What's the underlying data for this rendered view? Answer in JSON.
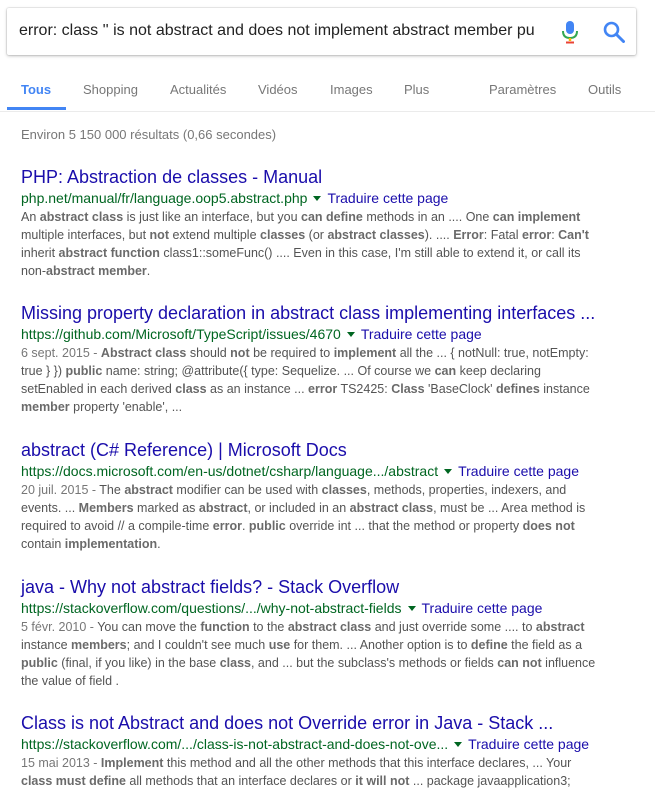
{
  "search": {
    "query": "error: class '' is not abstract and does not implement abstract member pu",
    "mic_icon": "microphone-icon",
    "search_icon": "magnifier-icon",
    "mic_colors": [
      "#4285f4",
      "#34a853",
      "#fbbc05",
      "#ea4335"
    ],
    "search_icon_color": "#4285f4"
  },
  "tabs": [
    {
      "label": "Tous",
      "active": true
    },
    {
      "label": "Shopping",
      "active": false
    },
    {
      "label": "Actualités",
      "active": false
    },
    {
      "label": "Vidéos",
      "active": false
    },
    {
      "label": "Images",
      "active": false
    },
    {
      "label": "Plus",
      "active": false
    }
  ],
  "tools": {
    "settings": "Paramètres",
    "tools": "Outils"
  },
  "stats": "Environ 5 150 000 résultats (0,66 secondes)",
  "translate_label": "Traduire cette page",
  "colors": {
    "title": "#1a0dab",
    "url": "#006621",
    "snippet": "#545454",
    "accent": "#4285f4"
  },
  "results": [
    {
      "title": "PHP: Abstraction de classes - Manual",
      "url": "php.net/manual/fr/language.oop5.abstract.php",
      "snippet": [
        [
          {
            "t": "An "
          },
          {
            "t": "abstract class",
            "b": true
          },
          {
            "t": " is just like an interface, but you "
          },
          {
            "t": "can define",
            "b": true
          },
          {
            "t": " methods in an .... One "
          },
          {
            "t": "can implement",
            "b": true
          }
        ],
        [
          {
            "t": "multiple interfaces, but "
          },
          {
            "t": "not",
            "b": true
          },
          {
            "t": " extend multiple "
          },
          {
            "t": "classes",
            "b": true
          },
          {
            "t": " (or "
          },
          {
            "t": "abstract classes",
            "b": true
          },
          {
            "t": "). .... "
          },
          {
            "t": "Error",
            "b": true
          },
          {
            "t": ": Fatal "
          },
          {
            "t": "error",
            "b": true
          },
          {
            "t": ": "
          },
          {
            "t": "Can't",
            "b": true
          }
        ],
        [
          {
            "t": "inherit "
          },
          {
            "t": "abstract function",
            "b": true
          },
          {
            "t": " class1::someFunc() .... Even in this case, I'm still able to extend it, or call its"
          }
        ],
        [
          {
            "t": "non-"
          },
          {
            "t": "abstract member",
            "b": true
          },
          {
            "t": "."
          }
        ]
      ]
    },
    {
      "title": "Missing property declaration in abstract class implementing interfaces ...",
      "url": "https://github.com/Microsoft/TypeScript/issues/4670",
      "snippet": [
        [
          {
            "t": "6 sept. 2015 - ",
            "d": true
          },
          {
            "t": "Abstract class",
            "b": true
          },
          {
            "t": " should "
          },
          {
            "t": "not",
            "b": true
          },
          {
            "t": " be required to "
          },
          {
            "t": "implement",
            "b": true
          },
          {
            "t": " all the ... { notNull: true, notEmpty:"
          }
        ],
        [
          {
            "t": "true } }) "
          },
          {
            "t": "public",
            "b": true
          },
          {
            "t": " name: string; @attribute({ type: Sequelize. ... Of course we "
          },
          {
            "t": "can",
            "b": true
          },
          {
            "t": " keep declaring"
          }
        ],
        [
          {
            "t": "setEnabled in each derived "
          },
          {
            "t": "class",
            "b": true
          },
          {
            "t": " as an instance ... "
          },
          {
            "t": "error",
            "b": true
          },
          {
            "t": " TS2425: "
          },
          {
            "t": "Class",
            "b": true
          },
          {
            "t": " 'BaseClock' "
          },
          {
            "t": "defines",
            "b": true
          },
          {
            "t": " instance"
          }
        ],
        [
          {
            "t": "member",
            "b": true
          },
          {
            "t": " property 'enable', ..."
          }
        ]
      ]
    },
    {
      "title": "abstract (C# Reference) | Microsoft Docs",
      "url": "https://docs.microsoft.com/en-us/dotnet/csharp/language.../abstract",
      "snippet": [
        [
          {
            "t": "20 juil. 2015 - ",
            "d": true
          },
          {
            "t": "The "
          },
          {
            "t": "abstract",
            "b": true
          },
          {
            "t": " modifier can be used with "
          },
          {
            "t": "classes",
            "b": true
          },
          {
            "t": ", methods, properties, indexers, and"
          }
        ],
        [
          {
            "t": "events. ... "
          },
          {
            "t": "Members",
            "b": true
          },
          {
            "t": " marked as "
          },
          {
            "t": "abstract",
            "b": true
          },
          {
            "t": ", or included in an "
          },
          {
            "t": "abstract class",
            "b": true
          },
          {
            "t": ", must be ... Area method is"
          }
        ],
        [
          {
            "t": "required to avoid // a compile-time "
          },
          {
            "t": "error",
            "b": true
          },
          {
            "t": ". "
          },
          {
            "t": "public",
            "b": true
          },
          {
            "t": " override int ... that the method or property "
          },
          {
            "t": "does not",
            "b": true
          }
        ],
        [
          {
            "t": "contain "
          },
          {
            "t": "implementation",
            "b": true
          },
          {
            "t": "."
          }
        ]
      ]
    },
    {
      "title": "java - Why not abstract fields? - Stack Overflow",
      "url": "https://stackoverflow.com/questions/.../why-not-abstract-fields",
      "snippet": [
        [
          {
            "t": "5 févr. 2010 - ",
            "d": true
          },
          {
            "t": "You can move the "
          },
          {
            "t": "function",
            "b": true
          },
          {
            "t": " to the "
          },
          {
            "t": "abstract class",
            "b": true
          },
          {
            "t": " and just override some .... to "
          },
          {
            "t": "abstract",
            "b": true
          }
        ],
        [
          {
            "t": "instance "
          },
          {
            "t": "members",
            "b": true
          },
          {
            "t": "; and I couldn't see much "
          },
          {
            "t": "use",
            "b": true
          },
          {
            "t": " for them. ... Another option is to "
          },
          {
            "t": "define",
            "b": true
          },
          {
            "t": " the field as a"
          }
        ],
        [
          {
            "t": "public",
            "b": true
          },
          {
            "t": " (final, if you like) in the base "
          },
          {
            "t": "class",
            "b": true
          },
          {
            "t": ", and ... but the subclass's methods or fields "
          },
          {
            "t": "can not",
            "b": true
          },
          {
            "t": " influence"
          }
        ],
        [
          {
            "t": "the value of field ."
          }
        ]
      ]
    },
    {
      "title": "Class is not Abstract and does not Override error in Java - Stack ...",
      "url": "https://stackoverflow.com/.../class-is-not-abstract-and-does-not-ove...",
      "snippet": [
        [
          {
            "t": "15 mai 2013 - ",
            "d": true
          },
          {
            "t": "Implement",
            "b": true
          },
          {
            "t": " this method and all the other methods that this interface declares, ... Your"
          }
        ],
        [
          {
            "t": "class",
            "b": true
          },
          {
            "t": " "
          },
          {
            "t": "must",
            "b": true
          },
          {
            "t": " "
          },
          {
            "t": "define",
            "b": true
          },
          {
            "t": " all methods that an interface declares or "
          },
          {
            "t": "it will not",
            "b": true
          },
          {
            "t": " ... package javaapplication3;"
          }
        ]
      ]
    }
  ]
}
